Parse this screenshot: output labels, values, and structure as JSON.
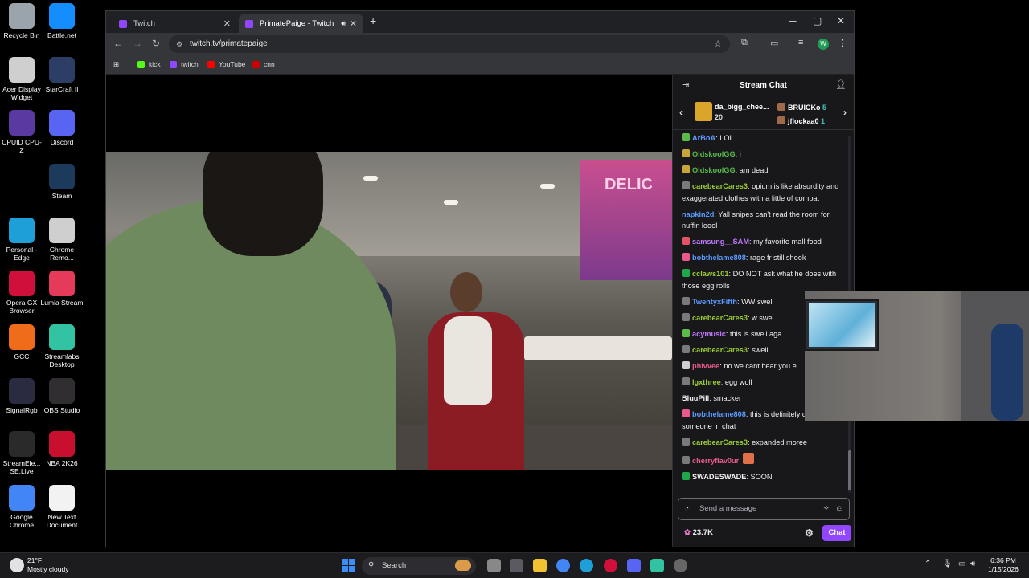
{
  "desktop": {
    "icons": [
      {
        "label": "Recycle Bin",
        "icon": "recycle-bin-icon",
        "color": "#9aa4ad"
      },
      {
        "label": "Battle.net",
        "icon": "battlenet-icon",
        "color": "#148eff"
      },
      {
        "label": "Acer Display Widget",
        "icon": "acer-icon",
        "color": "#cfcfcf"
      },
      {
        "label": "StarCraft II",
        "icon": "starcraft-icon",
        "color": "#2c3e66"
      },
      {
        "label": "CPUID CPU-Z",
        "icon": "cpuz-icon",
        "color": "#5a3aa0"
      },
      {
        "label": "Discord",
        "icon": "discord-icon",
        "color": "#5865f2"
      },
      {
        "label": "Steam",
        "icon": "steam-icon",
        "color": "#1b3a5c"
      },
      {
        "label": "Personal - Edge",
        "icon": "edge-icon",
        "color": "#1e9fd8"
      },
      {
        "label": "Chrome Remo...",
        "icon": "chrome-remote-icon",
        "color": "#cfcfcf"
      },
      {
        "label": "Opera GX Browser",
        "icon": "opera-icon",
        "color": "#d0103a"
      },
      {
        "label": "Lumia Stream",
        "icon": "lumia-icon",
        "color": "#e63a5a"
      },
      {
        "label": "GCC",
        "icon": "gcc-icon",
        "color": "#ef6c1a"
      },
      {
        "label": "Streamlabs Desktop",
        "icon": "streamlabs-icon",
        "color": "#31c3a2"
      },
      {
        "label": "SignalRgb",
        "icon": "signalrgb-icon",
        "color": "#2a2a40"
      },
      {
        "label": "OBS Studio",
        "icon": "obs-icon",
        "color": "#302e31"
      },
      {
        "label": "StreamEle... SE.Live",
        "icon": "streamelements-icon",
        "color": "#2a2a2a"
      },
      {
        "label": "NBA 2K26",
        "icon": "nba-icon",
        "color": "#c8102e"
      },
      {
        "label": "Google Chrome",
        "icon": "chrome-icon",
        "color": "#4285f4"
      },
      {
        "label": "New Text Document",
        "icon": "text-document-icon",
        "color": "#f2f2f2"
      }
    ]
  },
  "browser": {
    "tabs": [
      {
        "label": "Twitch",
        "active": false
      },
      {
        "label": "PrimatePaige - Twitch",
        "active": true
      }
    ],
    "new_tab": "+",
    "url": "twitch.tv/primatepaige",
    "profile_initial": "W",
    "bookmarks": [
      {
        "label": "kick",
        "color": "#53fc18"
      },
      {
        "label": "twitch",
        "color": "#9146ff"
      },
      {
        "label": "YouTube",
        "color": "#ff0000"
      },
      {
        "label": "cnn",
        "color": "#cc0000"
      }
    ]
  },
  "chat": {
    "title": "Stream Chat",
    "gifters": {
      "top_name": "da_bigg_chee...",
      "top_count": "20",
      "others": [
        {
          "name": "BRUICKo",
          "count": "5"
        },
        {
          "name": "jflockaa0",
          "count": "1"
        }
      ]
    },
    "messages": [
      {
        "user": "ArBoA",
        "color": "#5b9bff",
        "text": "LOL",
        "badge": "#5bba4a"
      },
      {
        "user": "OldskoolGG",
        "color": "#5bba4a",
        "text": "i",
        "badge": "#c9a43a"
      },
      {
        "user": "OldskoolGG",
        "color": "#5bba4a",
        "text": "am dead",
        "badge": "#c9a43a"
      },
      {
        "user": "carebearCares3",
        "color": "#9acd32",
        "text": "opium is like absurdity and exaggerated clothes with a little of combat",
        "badge": "#7a7a7a"
      },
      {
        "user": "napkin2d",
        "color": "#5b9bff",
        "text": "Yall snipes can't read the room for nuffin loool",
        "badge": ""
      },
      {
        "user": "samsung__SAM",
        "color": "#c07aff",
        "text": "my favorite mall food",
        "badge": "#e0546a"
      },
      {
        "user": "bobthelame808",
        "color": "#5b9bff",
        "text": "rage fr still shook",
        "badge": "#e85a8a"
      },
      {
        "user": "cclaws101",
        "color": "#9acd32",
        "text": "DO NOT ask what he does with those egg rolls",
        "badge": "#1fa84a"
      },
      {
        "user": "TwentyxFifth",
        "color": "#5b9bff",
        "text": "WW swell",
        "badge": "#7a7a7a"
      },
      {
        "user": "carebearCares3",
        "color": "#9acd32",
        "text": "w swe",
        "badge": "#7a7a7a"
      },
      {
        "user": "acymusic",
        "color": "#c07aff",
        "text": "this is swell aga",
        "badge": "#5bba4a"
      },
      {
        "user": "carebearCares3",
        "color": "#9acd32",
        "text": "swell",
        "badge": "#7a7a7a"
      },
      {
        "user": "phivvee",
        "color": "#e85a8a",
        "text": "no we cant hear you e",
        "badge": "#cfcfcf"
      },
      {
        "user": "lgxthree",
        "color": "#9acd32",
        "text": "egg woll",
        "badge": "#7a7a7a"
      },
      {
        "user": "BluuPill",
        "color": "#efeff1",
        "text": "smacker",
        "badge": ""
      },
      {
        "user": "bobthelame808",
        "color": "#5b9bff",
        "text": "this is definitely doing it for someone in chat",
        "badge": "#e85a8a"
      },
      {
        "user": "carebearCares3",
        "color": "#9acd32",
        "text": "expanded moree",
        "badge": "#7a7a7a"
      },
      {
        "user": "cherryflav0ur",
        "color": "#e85a8a",
        "text": "",
        "badge": "#7a7a7a"
      },
      {
        "user": "SWADESWADE",
        "color": "#efeff1",
        "text": "SOON",
        "badge": "#1fa84a"
      }
    ],
    "input_placeholder": "Send a message",
    "points": "23.7K",
    "chat_button": "Chat"
  },
  "taskbar": {
    "weather_temp": "21°F",
    "weather_cond": "Mostly cloudy",
    "search": "Search",
    "time": "6:36 PM",
    "date": "1/15/2026"
  }
}
